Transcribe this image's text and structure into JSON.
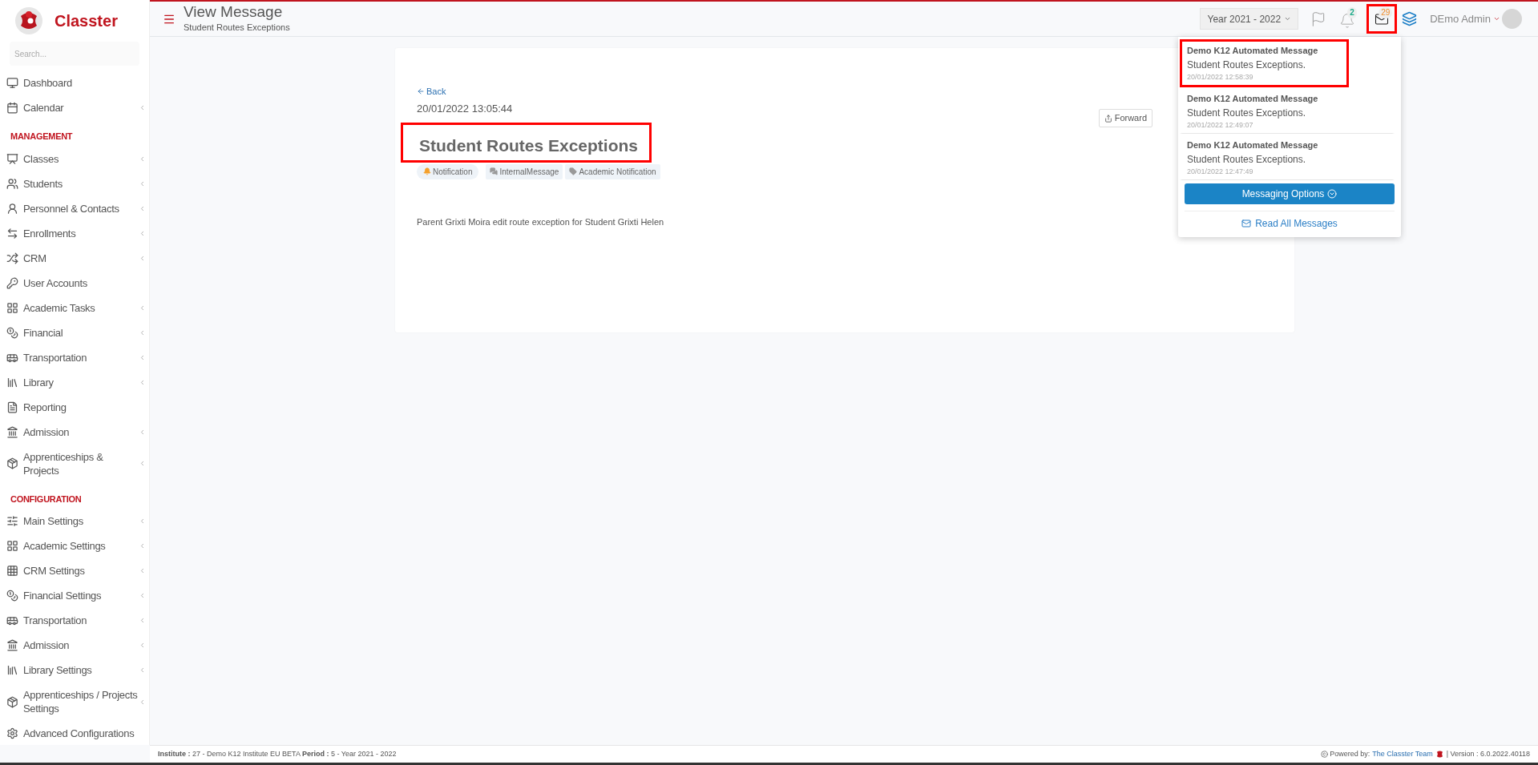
{
  "brand": {
    "name": "Classter"
  },
  "sidebar": {
    "search": {
      "placeholder": "Search..."
    },
    "items": [
      {
        "kind": "item",
        "label": "Dashboard",
        "has_submenu": false
      },
      {
        "kind": "item",
        "label": "Calendar",
        "has_submenu": true
      },
      {
        "kind": "heading",
        "label": "MANAGEMENT"
      },
      {
        "kind": "item",
        "label": "Classes",
        "has_submenu": true
      },
      {
        "kind": "item",
        "label": "Students",
        "has_submenu": true
      },
      {
        "kind": "item",
        "label": "Personnel & Contacts",
        "has_submenu": true
      },
      {
        "kind": "item",
        "label": "Enrollments",
        "has_submenu": true
      },
      {
        "kind": "item",
        "label": "CRM",
        "has_submenu": true
      },
      {
        "kind": "item",
        "label": "User Accounts",
        "has_submenu": false
      },
      {
        "kind": "item",
        "label": "Academic Tasks",
        "has_submenu": true
      },
      {
        "kind": "item",
        "label": "Financial",
        "has_submenu": true
      },
      {
        "kind": "item",
        "label": "Transportation",
        "has_submenu": true
      },
      {
        "kind": "item",
        "label": "Library",
        "has_submenu": true
      },
      {
        "kind": "item",
        "label": "Reporting",
        "has_submenu": false
      },
      {
        "kind": "item",
        "label": "Admission",
        "has_submenu": true
      },
      {
        "kind": "item",
        "label": "Apprenticeships & Projects",
        "has_submenu": true
      },
      {
        "kind": "heading",
        "label": "CONFIGURATION"
      },
      {
        "kind": "item",
        "label": "Main Settings",
        "has_submenu": true
      },
      {
        "kind": "item",
        "label": "Academic Settings",
        "has_submenu": true
      },
      {
        "kind": "item",
        "label": "CRM Settings",
        "has_submenu": true
      },
      {
        "kind": "item",
        "label": "Financial Settings",
        "has_submenu": true
      },
      {
        "kind": "item",
        "label": "Transportation",
        "has_submenu": true
      },
      {
        "kind": "item",
        "label": "Admission",
        "has_submenu": true
      },
      {
        "kind": "item",
        "label": "Library Settings",
        "has_submenu": true
      },
      {
        "kind": "item",
        "label": "Apprenticeships / Projects Settings",
        "has_submenu": true
      },
      {
        "kind": "item",
        "label": "Advanced Configurations",
        "has_submenu": false
      }
    ]
  },
  "header": {
    "title": "View Message",
    "subtitle": "Student Routes Exceptions",
    "year": "Year 2021 - 2022",
    "notifications_count": "2",
    "messages_count": "29",
    "messages_highlighted": true,
    "user": "DEmo Admin"
  },
  "message": {
    "back": "Back",
    "date": "20/01/2022 13:05:44",
    "forward": "Forward",
    "title": "Student Routes Exceptions",
    "title_highlighted": true,
    "tags": [
      {
        "kind": "notification",
        "label": "Notification"
      },
      {
        "kind": "internal",
        "label": "InternalMessage"
      },
      {
        "kind": "category",
        "label": "Academic Notification"
      }
    ],
    "body": "Parent Grixti Moira edit route exception for Student Grixti Helen"
  },
  "messages_dropdown": {
    "items": [
      {
        "sender": "Demo K12 Automated Message",
        "subject": "Student Routes Exceptions.",
        "time": "20/01/2022 12:58:39",
        "highlighted": true
      },
      {
        "sender": "Demo K12 Automated Message",
        "subject": "Student Routes Exceptions.",
        "time": "20/01/2022 12:49:07",
        "highlighted": false
      },
      {
        "sender": "Demo K12 Automated Message",
        "subject": "Student Routes Exceptions.",
        "time": "20/01/2022 12:47:49",
        "highlighted": false
      }
    ],
    "options_button": "Messaging Options",
    "read_all": "Read All Messages"
  },
  "footer": {
    "info": "**Institute :** 27 - Demo K12 Institute EU BETA **Period :** 5 - Year 2021 - 2022",
    "powered_by": "Powered by:",
    "team_link": "The Classter Team",
    "version": "| Version : 6.0.2022.40118"
  }
}
